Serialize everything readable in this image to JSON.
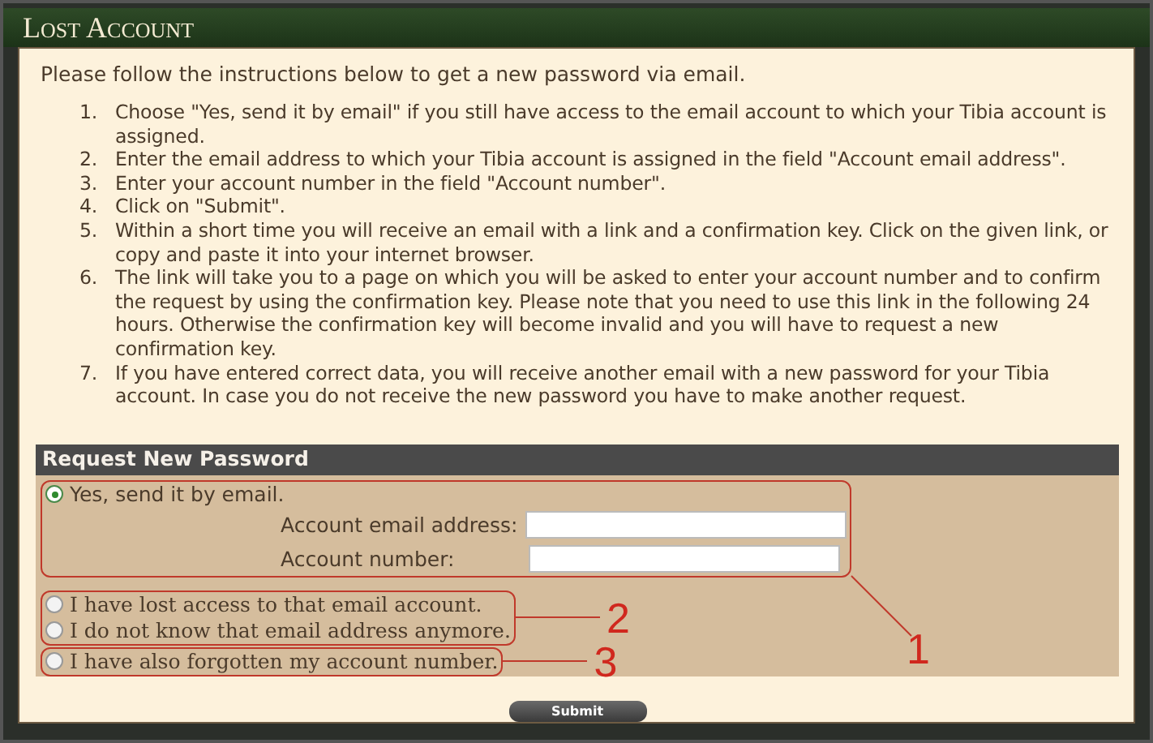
{
  "window": {
    "title": "Lost Account"
  },
  "intro": "Please follow the instructions below to get a new password via email.",
  "instructions": [
    {
      "number": "1.",
      "text": "Choose \"Yes, send it by email\" if you still have access to the email account to which your Tibia account is assigned."
    },
    {
      "number": "2.",
      "text": "Enter the email address to which your Tibia account is assigned in the field \"Account email address\"."
    },
    {
      "number": "3.",
      "text": "Enter your account number in the field \"Account number\"."
    },
    {
      "number": "4.",
      "text": "Click on \"Submit\"."
    },
    {
      "number": "5.",
      "text": "Within a short time you will receive an email with a link and a confirmation key. Click on the given link, or copy and paste it into your internet browser."
    },
    {
      "number": "6.",
      "text": "The link will take you to a page on which you will be asked to enter your account number and to confirm the request by using the confirmation key. Please note that you need to use this link in the following 24 hours. Otherwise the confirmation key will become invalid and you will have to request a new confirmation key."
    },
    {
      "number": "7.",
      "text": "If you have entered correct data, you will receive another email with a new password for your Tibia account. In case you do not receive the new password you have to make another request."
    }
  ],
  "form": {
    "title": "Request New Password",
    "groups": [
      {
        "annotation": "1",
        "options": [
          {
            "label": "Yes, send it by email.",
            "selected": true
          }
        ],
        "fields": [
          {
            "label": "Account email address:"
          },
          {
            "label": "Account number:"
          }
        ]
      },
      {
        "annotation": "2",
        "options": [
          {
            "label": "I have lost access to that email account.",
            "selected": false
          },
          {
            "label": "I do not know that email address anymore.",
            "selected": false
          }
        ]
      },
      {
        "annotation": "3",
        "options": [
          {
            "label": "I have also forgotten my account number.",
            "selected": false
          }
        ]
      }
    ],
    "submit": "Submit"
  }
}
